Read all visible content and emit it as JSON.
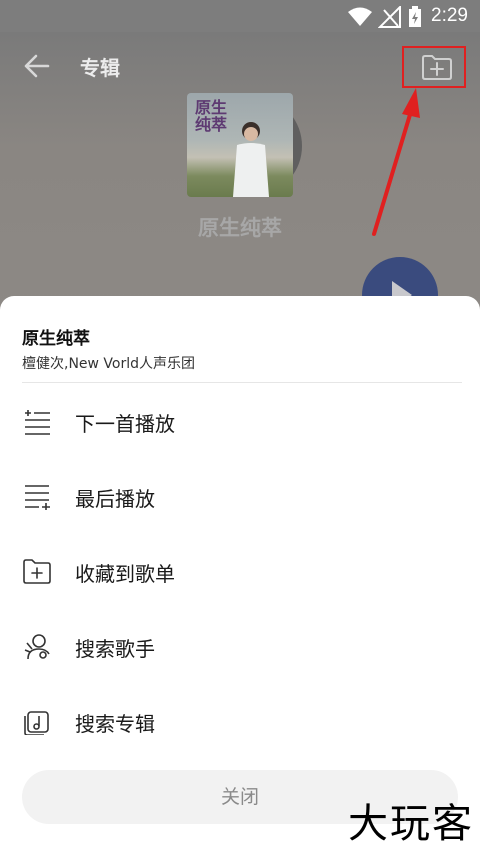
{
  "status_bar": {
    "time": "2:29"
  },
  "header": {
    "title": "专辑"
  },
  "album": {
    "title": "原生纯萃",
    "cover_text": "原生纯萃"
  },
  "sheet": {
    "song_title": "原生纯萃",
    "artist": "檀健次,New Vorld人声乐团",
    "menu": [
      {
        "label": "下一首播放",
        "icon": "play-next-icon"
      },
      {
        "label": "最后播放",
        "icon": "play-last-icon"
      },
      {
        "label": "收藏到歌单",
        "icon": "add-to-playlist-icon"
      },
      {
        "label": "搜索歌手",
        "icon": "search-singer-icon"
      },
      {
        "label": "搜索专辑",
        "icon": "search-album-icon"
      }
    ],
    "close_label": "关闭"
  },
  "watermark": "大玩客",
  "colors": {
    "highlight": "#e02020",
    "fab": "#3a4b7e",
    "sheet_bg": "#ffffff"
  }
}
